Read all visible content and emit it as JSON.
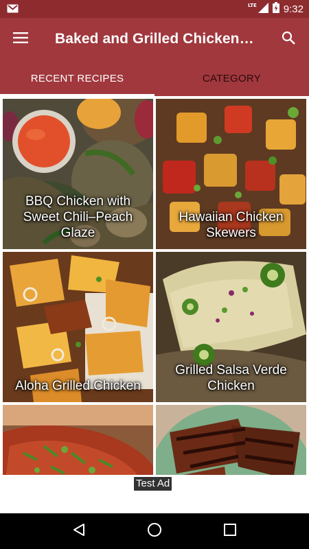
{
  "status_bar": {
    "time": "9:32",
    "network": "LTE",
    "icons": [
      "gmail-icon",
      "signal-icon",
      "battery-charging-icon"
    ]
  },
  "app_bar": {
    "title": "Baked and Grilled Chicken R…",
    "icons": [
      "menu-icon",
      "search-icon"
    ]
  },
  "tabs": [
    {
      "label": "RECENT RECIPES",
      "active": true
    },
    {
      "label": "CATEGORY",
      "active": false
    }
  ],
  "recipes": [
    {
      "title": "BBQ Chicken with Sweet Chili–Peach Glaze"
    },
    {
      "title": "Hawaiian Chicken Skewers"
    },
    {
      "title": "Aloha Grilled Chicken"
    },
    {
      "title": "Grilled Salsa Verde Chicken"
    },
    {
      "title": ""
    },
    {
      "title": ""
    }
  ],
  "ad": {
    "label": "Test Ad"
  },
  "nav_bar": {
    "icons": [
      "back-icon",
      "home-icon",
      "recents-icon"
    ]
  },
  "colors": {
    "primary_dark": "#8e2b2f",
    "primary": "#a0383d"
  }
}
